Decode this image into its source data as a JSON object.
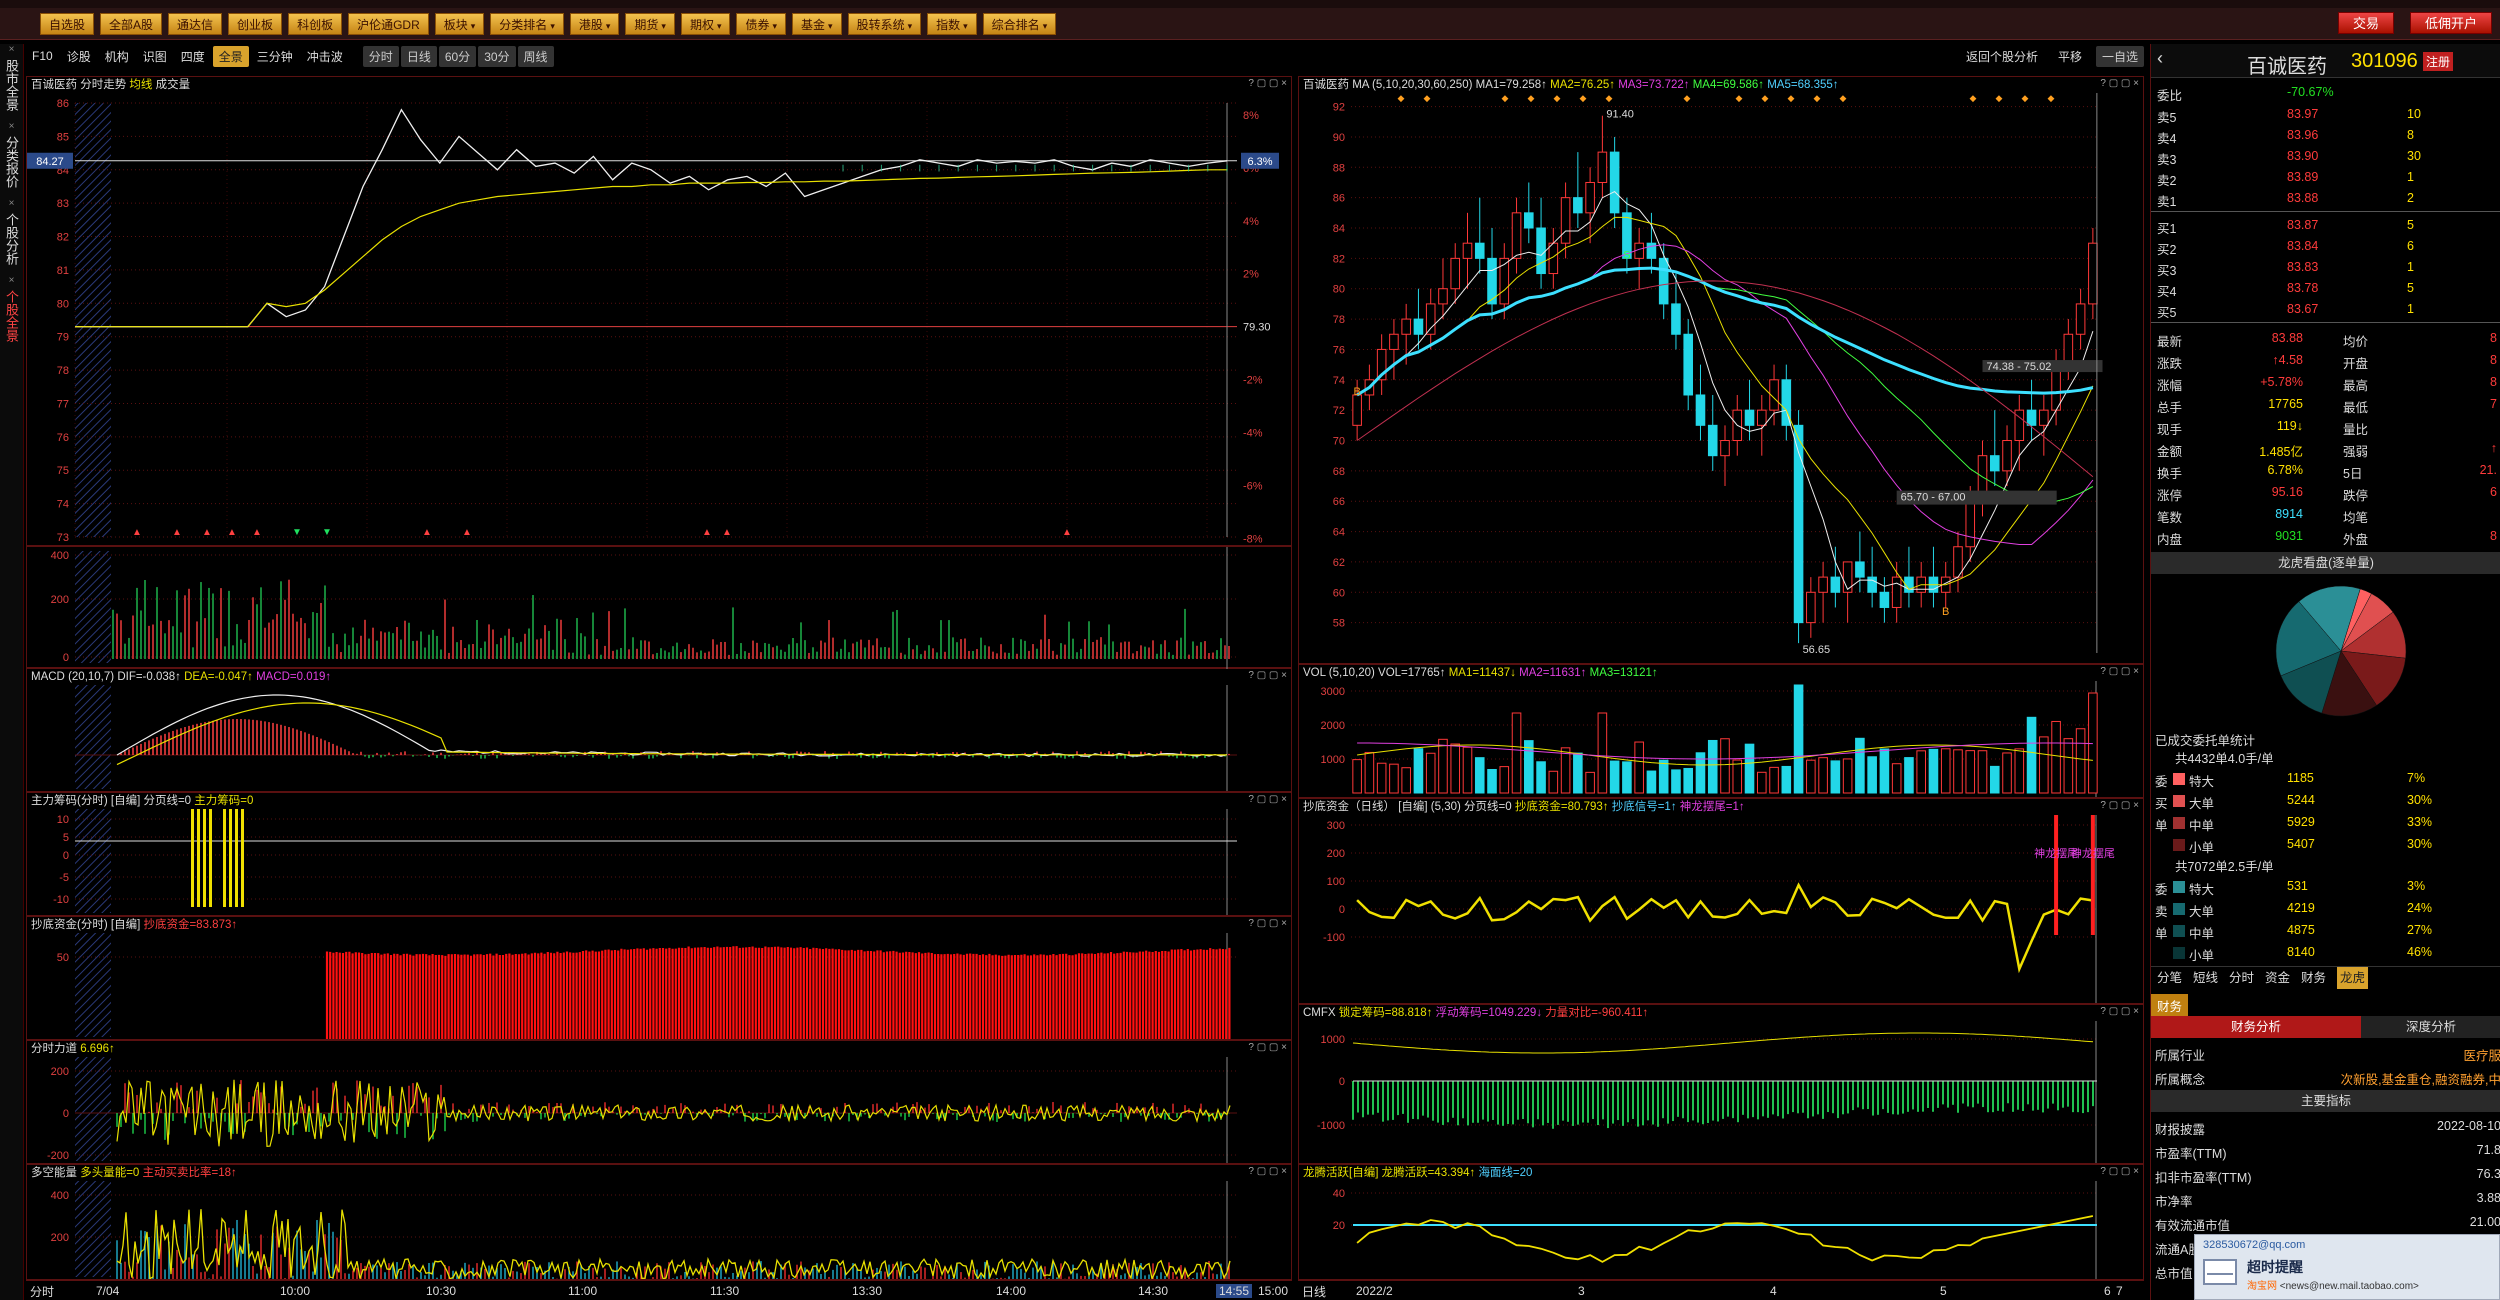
{
  "app": {
    "window_title": "百诚医药"
  },
  "topbar": {
    "buttons": [
      "自选股",
      "全部A股",
      "通达信",
      "创业板",
      "科创板",
      "沪伦通GDR",
      "板块",
      "分类排名",
      "港股",
      "期货",
      "期权",
      "债券",
      "基金",
      "股转系统",
      "指数",
      "综合排名"
    ],
    "right_buttons": [
      "交易",
      "低佣开户"
    ]
  },
  "toolbar2": {
    "left": [
      "F10",
      "诊股",
      "机构",
      "识图",
      "四度",
      "全景",
      "三分钟",
      "冲击波",
      "分时",
      "日线",
      "60分",
      "30分",
      "周线"
    ],
    "active": "全景",
    "right": [
      "返回个股分析",
      "平移",
      "一自选"
    ]
  },
  "vtabs": [
    {
      "label": "股市全景",
      "red": false
    },
    {
      "label": "分类报价",
      "red": false
    },
    {
      "label": "个股分析",
      "red": false
    },
    {
      "label": "个股全景",
      "red": true
    }
  ],
  "left": {
    "intraday": {
      "header_stock": "百诚医药",
      "header_mode": "分时走势",
      "header_price": "均线",
      "header_vol": "成交量",
      "price_ticks": [
        "86",
        "85",
        "84",
        "83",
        "82",
        "81",
        "80",
        "79",
        "78",
        "77",
        "76",
        "75",
        "74",
        "73"
      ],
      "pct_ticks": [
        "8%",
        "6%",
        "4%",
        "2%",
        "",
        "-2%",
        "-4%",
        "-6%",
        "-8%"
      ],
      "prev_close": "79.30",
      "last_price": "84.27",
      "last_pct": "6.3%",
      "price_series": [
        79.3,
        79.3,
        79.3,
        79.3,
        79.3,
        79.3,
        79.3,
        79.3,
        79.3,
        79.3,
        80.0,
        79.6,
        79.8,
        80.5,
        82.0,
        83.5,
        84.6,
        85.8,
        84.9,
        84.2,
        85.0,
        84.5,
        84.0,
        84.6,
        84.1,
        84.2,
        83.9,
        84.4,
        83.7,
        84.2,
        84.0,
        83.6,
        83.8,
        83.4,
        83.7,
        83.8,
        83.5,
        83.9,
        83.2,
        83.4,
        83.6,
        83.8,
        84.0,
        84.1,
        84.3,
        84.2,
        84.1,
        84.3,
        84.2,
        84.25,
        84.2,
        84.3,
        84.1,
        84.0,
        84.2,
        84.1,
        84.3,
        84.2,
        84.1,
        84.2,
        84.27
      ],
      "avg_series": [
        79.3,
        79.3,
        79.3,
        79.3,
        79.3,
        79.3,
        79.3,
        79.3,
        79.3,
        79.3,
        80.0,
        79.9,
        80.0,
        80.4,
        80.9,
        81.4,
        81.9,
        82.3,
        82.6,
        82.8,
        83.0,
        83.1,
        83.2,
        83.25,
        83.3,
        83.35,
        83.4,
        83.45,
        83.5,
        83.5,
        83.55,
        83.55,
        83.6,
        83.6,
        83.6,
        83.62,
        83.62,
        83.64,
        83.64,
        83.66,
        83.66,
        83.68,
        83.7,
        83.72,
        83.74,
        83.75,
        83.77,
        83.79,
        83.8,
        83.82,
        83.84,
        83.86,
        83.88,
        83.9,
        83.91,
        83.92,
        83.94,
        83.96,
        83.98,
        84.0,
        84.0
      ],
      "vol_ticks": [
        "400",
        "200",
        "0"
      ],
      "time_labels": [
        "7/04",
        "10:00",
        "10:30",
        "11:00",
        "11:30",
        "13:30",
        "14:00",
        "14:30",
        "14:55",
        "15:00"
      ],
      "time_btn": "分时"
    },
    "macd": {
      "name": "MACD",
      "params": "(20,10,7)",
      "dif": "DIF=-0.038↑",
      "dea": "DEA=-0.047↑",
      "macd": "MACD=0.019↑"
    },
    "zlcm": {
      "name": "主力筹码(分时)",
      "tag": "[自编]",
      "line": "分页线=0",
      "val": "主力筹码=0",
      "ticks": [
        "10",
        "5",
        "0",
        "-5",
        "-10"
      ]
    },
    "cdzj": {
      "name": "抄底资金(分时)",
      "tag": "[自编]",
      "val": "抄底资金=83.873↑",
      "ticks": [
        "50"
      ]
    },
    "fsld": {
      "name": "分时力道",
      "val": "6.696↑",
      "ticks": [
        "200",
        "0",
        "-200"
      ]
    },
    "dkn": {
      "name": "多空能量",
      "val1": "多头量能=0",
      "val2": "主动买卖比率=18↑",
      "ticks": [
        "400",
        "200"
      ]
    }
  },
  "mid": {
    "kline": {
      "header_stock": "百诚医药",
      "ma_label": "MA",
      "params": "(5,10,20,30,60,250)",
      "ma1": "MA1=79.258↑",
      "ma2": "MA2=76.25↑",
      "ma3": "MA3=73.722↑",
      "ma4": "MA4=69.586↑",
      "ma5": "MA5=68.355↑",
      "price_ticks": [
        "92",
        "90",
        "88",
        "86",
        "84",
        "82",
        "80",
        "78",
        "76",
        "74",
        "72",
        "70",
        "68",
        "66",
        "64",
        "62",
        "60",
        "58"
      ],
      "ann_high": "91.40",
      "ann_low": "56.65",
      "ann_box1": "74.38 - 75.02",
      "ann_box2": "65.70 - 67.00",
      "sig_b": "B",
      "sig_s": "S",
      "candles": [
        [
          71,
          74,
          70,
          73
        ],
        [
          73,
          75,
          72,
          74
        ],
        [
          74,
          77,
          73,
          76
        ],
        [
          76,
          78,
          74,
          77
        ],
        [
          77,
          79,
          75,
          78
        ],
        [
          78,
          80,
          76,
          77
        ],
        [
          77,
          80,
          76,
          79
        ],
        [
          79,
          82,
          78,
          80
        ],
        [
          80,
          83,
          79,
          82
        ],
        [
          82,
          85,
          80,
          83
        ],
        [
          83,
          86,
          81,
          82
        ],
        [
          82,
          84,
          78,
          79
        ],
        [
          79,
          83,
          78,
          82
        ],
        [
          82,
          86,
          81,
          85
        ],
        [
          85,
          87,
          83,
          84
        ],
        [
          84,
          86,
          80,
          81
        ],
        [
          81,
          84,
          80,
          83
        ],
        [
          83,
          87,
          82,
          86
        ],
        [
          86,
          89,
          84,
          85
        ],
        [
          85,
          88,
          83,
          87
        ],
        [
          87,
          91.4,
          86,
          89
        ],
        [
          89,
          90,
          84,
          85
        ],
        [
          85,
          86,
          81,
          82
        ],
        [
          82,
          84,
          80,
          83
        ],
        [
          83,
          85,
          81,
          82
        ],
        [
          82,
          83,
          78,
          79
        ],
        [
          79,
          81,
          76,
          77
        ],
        [
          77,
          78,
          72,
          73
        ],
        [
          73,
          75,
          70,
          71
        ],
        [
          71,
          73,
          68,
          69
        ],
        [
          69,
          71,
          67,
          70
        ],
        [
          70,
          73,
          69,
          72
        ],
        [
          72,
          74,
          70,
          71
        ],
        [
          71,
          73,
          69,
          72
        ],
        [
          72,
          75,
          71,
          74
        ],
        [
          74,
          75,
          70,
          71
        ],
        [
          71,
          72,
          56.65,
          58
        ],
        [
          58,
          61,
          57,
          60
        ],
        [
          60,
          62,
          58,
          61
        ],
        [
          61,
          63,
          59,
          60
        ],
        [
          60,
          62,
          58,
          62
        ],
        [
          62,
          64,
          60,
          61
        ],
        [
          61,
          63,
          59,
          60
        ],
        [
          60,
          61,
          58,
          59
        ],
        [
          59,
          62,
          58,
          61
        ],
        [
          61,
          63,
          59,
          60
        ],
        [
          60,
          62,
          59,
          61
        ],
        [
          61,
          63,
          59,
          60
        ],
        [
          60,
          62,
          59,
          61
        ],
        [
          61,
          64,
          60,
          63
        ],
        [
          63,
          67,
          62,
          66
        ],
        [
          66,
          70,
          65,
          69
        ],
        [
          69,
          72,
          67,
          68
        ],
        [
          68,
          71,
          67,
          70
        ],
        [
          70,
          73,
          68,
          72
        ],
        [
          72,
          74,
          70,
          71
        ],
        [
          71,
          73,
          69,
          72
        ],
        [
          72,
          76,
          71,
          75
        ],
        [
          75,
          78,
          74,
          77
        ],
        [
          77,
          80,
          76,
          79
        ],
        [
          79,
          84,
          78,
          83
        ]
      ],
      "date_labels": [
        "2022/2",
        "3",
        "4",
        "5",
        "6",
        "7"
      ],
      "date_btn": "日线"
    },
    "vol": {
      "name": "VOL",
      "params": "(5,10,20)",
      "val": "VOL=17765↑",
      "ma1": "MA1=11437↓",
      "ma2": "MA2=11631↑",
      "ma3": "MA3=13121↑",
      "ticks": [
        "3000",
        "2000",
        "1000"
      ]
    },
    "cdzj": {
      "name": "抄底资金（日线）",
      "tag": "[自编]",
      "params": "(5,30)",
      "line": "分页线=0",
      "val": "抄底资金=80.793↑",
      "s1": "抄底信号=1↑",
      "s2": "神龙摆尾=1↑",
      "ticks": [
        "300",
        "200",
        "100",
        "0",
        "-100"
      ],
      "ann": [
        "神龙摆尾",
        "神龙摆尾"
      ]
    },
    "cmfx": {
      "name": "CMFX",
      "val1": "锁定筹码=88.818↑",
      "val2": "浮动筹码=1049.229↓",
      "val3": "力量对比=-960.411↑",
      "ticks": [
        "1000",
        "0",
        "-1000"
      ]
    },
    "lthy": {
      "name": "龙腾活跃[自编]",
      "val1": "龙腾活跃=43.394↑",
      "val2": "海面线=20",
      "ticks": [
        "40",
        "20"
      ]
    }
  },
  "right": {
    "stock_name": "百诚医药",
    "stock_code": "301096",
    "tag": "注册",
    "weibi_label": "委比",
    "weibi_val": "-70.67%",
    "weibi_cha": "-",
    "sell": [
      [
        "卖5",
        "83.97",
        "10"
      ],
      [
        "卖4",
        "83.96",
        "8"
      ],
      [
        "卖3",
        "83.90",
        "30"
      ],
      [
        "卖2",
        "83.89",
        "1"
      ],
      [
        "卖1",
        "83.88",
        "2"
      ]
    ],
    "buy": [
      [
        "买1",
        "83.87",
        "5"
      ],
      [
        "买2",
        "83.84",
        "6"
      ],
      [
        "买3",
        "83.83",
        "1"
      ],
      [
        "买4",
        "83.78",
        "5"
      ],
      [
        "买5",
        "83.67",
        "1"
      ]
    ],
    "stats": [
      [
        "最新",
        "83.88",
        "均价",
        "8"
      ],
      [
        "涨跌",
        "↑4.58",
        "开盘",
        "8"
      ],
      [
        "涨幅",
        "+5.78%",
        "最高",
        "8"
      ],
      [
        "总手",
        "17765",
        "最低",
        "7"
      ],
      [
        "现手",
        "119↓",
        "量比",
        ""
      ],
      [
        "金额",
        "1.485亿",
        "强弱",
        "↑"
      ],
      [
        "换手",
        "6.78%",
        "5日",
        "21."
      ],
      [
        "涨停",
        "95.16",
        "跌停",
        "6"
      ],
      [
        "笔数",
        "8914",
        "均笔",
        ""
      ],
      [
        "内盘",
        "9031",
        "外盘",
        "8"
      ]
    ],
    "lhb_title": "龙虎看盘(逐单量)",
    "pie": [
      {
        "v": 3,
        "c": "#ff6060"
      },
      {
        "v": 7,
        "c": "#e05050"
      },
      {
        "v": 12,
        "c": "#b03030"
      },
      {
        "v": 14,
        "c": "#7a1a1a"
      },
      {
        "v": 14,
        "c": "#3a1010"
      },
      {
        "v": 14,
        "c": "#0f4f52"
      },
      {
        "v": 20,
        "c": "#166a70"
      },
      {
        "v": 16,
        "c": "#2b8f96"
      }
    ],
    "order_stat_title": "已成交委托单统计",
    "buy_total": "共4432单4.0手/单",
    "buy_rows": [
      [
        "委",
        "特大",
        "1185",
        "7%"
      ],
      [
        "买",
        "大单",
        "5244",
        "30%"
      ],
      [
        "单",
        "中单",
        "5929",
        "33%"
      ],
      [
        "",
        "小单",
        "5407",
        "30%"
      ]
    ],
    "sell_total": "共7072单2.5手/单",
    "sell_rows": [
      [
        "委",
        "特大",
        "531",
        "3%"
      ],
      [
        "卖",
        "大单",
        "4219",
        "24%"
      ],
      [
        "单",
        "中单",
        "4875",
        "27%"
      ],
      [
        "",
        "小单",
        "8140",
        "46%"
      ]
    ],
    "tabs": [
      "分笔",
      "短线",
      "分时",
      "资金",
      "财务",
      "龙虎"
    ],
    "tab_active": "龙虎",
    "fin_tab": "财务",
    "fin_sub": [
      "财务分析",
      "深度分析"
    ],
    "fin": [
      [
        "所属行业",
        "医疗服"
      ],
      [
        "所属概念",
        "次新股,基金重仓,融资融券,中"
      ]
    ],
    "main_idx": "主要指标",
    "fin2": [
      [
        "财报披露",
        "2022-08-10"
      ],
      [
        "市盈率(TTM)",
        "71.8"
      ],
      [
        "扣非市盈率(TTM)",
        "76.3"
      ],
      [
        "市净率",
        "3.88"
      ],
      [
        "有效流通市值",
        "21.00"
      ],
      [
        "流通A股",
        ""
      ],
      [
        "总市值",
        ""
      ]
    ]
  },
  "popup": {
    "email": "328530672@qq.com",
    "title": "超时提醒",
    "src": "淘宝网",
    "from": "<news@new.mail.taobao.com>"
  }
}
